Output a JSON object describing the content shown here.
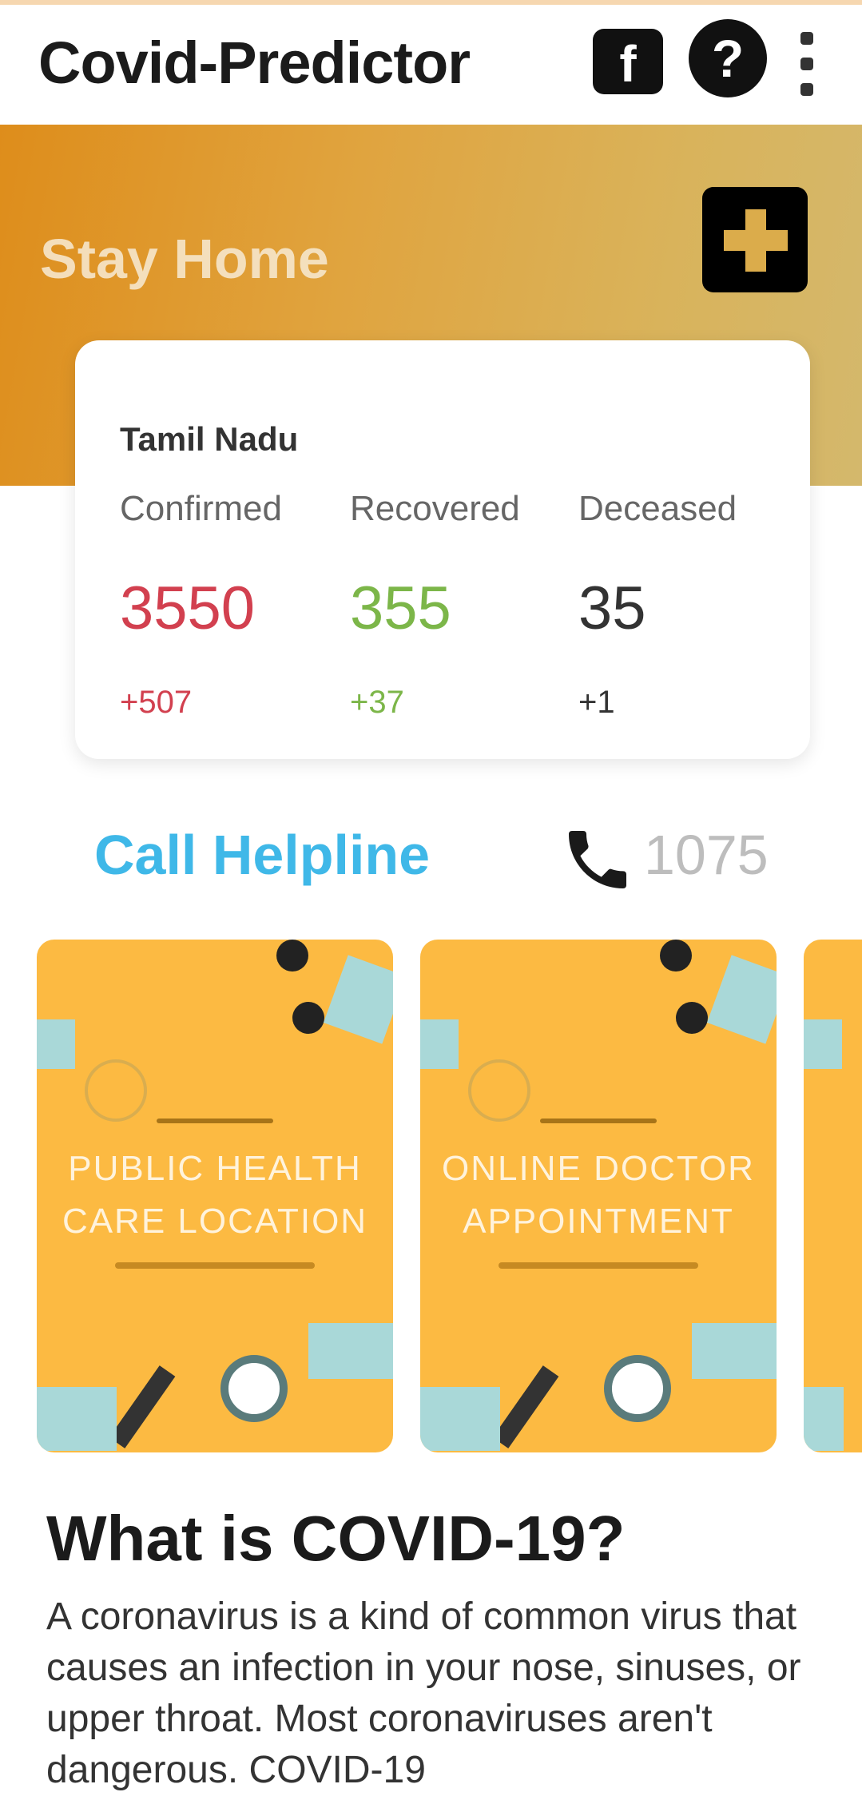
{
  "appbar": {
    "title": "Covid-Predictor",
    "facebook_icon_glyph": "f",
    "help_icon_glyph": "?",
    "icons": [
      "facebook-icon",
      "help-icon",
      "more-vert-icon"
    ]
  },
  "banner": {
    "title": "Stay Home",
    "icon": "medical-cross-icon",
    "gradient_start": "#de8d1b",
    "gradient_end": "#d4b86c"
  },
  "stats": {
    "region": "Tamil Nadu",
    "confirmed": {
      "label": "Confirmed",
      "value": "3550",
      "delta": "+507"
    },
    "recovered": {
      "label": "Recovered",
      "value": "355",
      "delta": "+37"
    },
    "deceased": {
      "label": "Deceased",
      "value": "35",
      "delta": "+1"
    },
    "colors": {
      "confirmed": "#d2404f",
      "recovered": "#7cb649",
      "deceased": "#333333"
    }
  },
  "helpline": {
    "label": "Call Helpline",
    "number": "1075",
    "icon": "phone-icon",
    "label_color": "#3fb8e8"
  },
  "carousel": {
    "items": [
      {
        "line1": "PUBLIC HEALTH",
        "line2": "CARE LOCATION"
      },
      {
        "line1": "ONLINE DOCTOR",
        "line2": "APPOINTMENT"
      }
    ],
    "card_color": "#fcba42"
  },
  "info": {
    "title": "What is COVID-19?",
    "body": "A coronavirus is a kind of common virus that causes an infection in your nose, sinuses, or upper throat. Most coronaviruses aren't dangerous. COVID-19"
  }
}
